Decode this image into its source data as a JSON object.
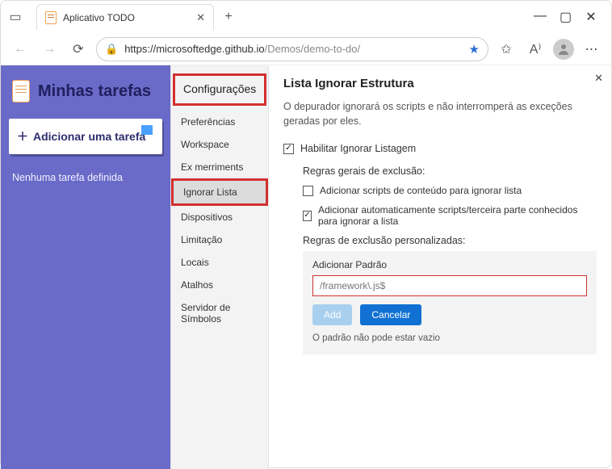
{
  "browser": {
    "tab_title": "Aplicativo TODO",
    "url_host": "https://microsoftedge.github.io",
    "url_path": "/Demos/demo-to-do/"
  },
  "app": {
    "title": "Minhas tarefas",
    "add_task": "Adicionar uma tarefa",
    "empty": "Nenhuma tarefa definida"
  },
  "settings_sidebar": {
    "heading": "Configurações",
    "items": [
      "Preferências",
      "Workspace",
      "Ex merriments",
      "Ignorar Lista",
      "Dispositivos",
      "Limitação",
      "Locais",
      "Atalhos",
      "Servidor de Símbolos"
    ],
    "active_index": 3
  },
  "panel": {
    "title": "Lista Ignorar Estrutura",
    "description": "O depurador ignorará os scripts e não interromperá as exceções geradas por eles.",
    "enable_label": "Habilitar Ignorar Listagem",
    "general_rules_title": "Regras gerais de exclusão:",
    "rule_content_scripts": "Adicionar scripts de conteúdo para ignorar lista",
    "rule_auto_thirdparty": "Adicionar automaticamente scripts/terceira parte conhecidos para ignorar a lista",
    "custom_rules_title": "Regras de exclusão personalizadas:",
    "pattern_label": "Adicionar Padrão",
    "pattern_placeholder": "/framework\\.js$",
    "btn_add": "Add",
    "btn_cancel": "Cancelar",
    "error_msg": "O padrão não pode estar vazio"
  }
}
